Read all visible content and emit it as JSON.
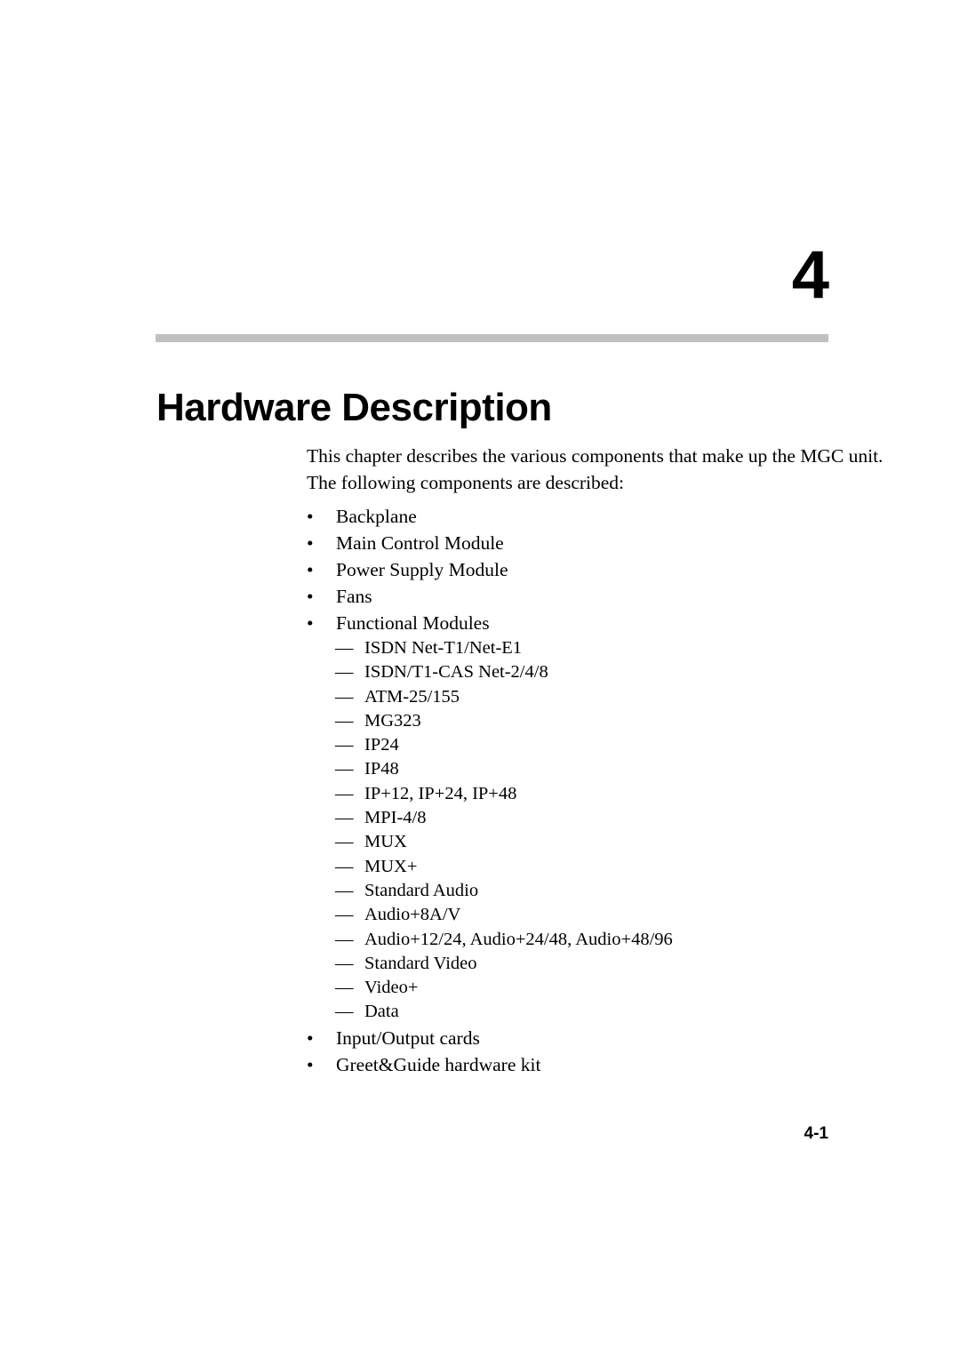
{
  "document": {
    "chapter_number": "4",
    "chapter_title": "Hardware Description",
    "rule_color": "#c0c0c0",
    "text_color": "#000000",
    "background_color": "#ffffff"
  },
  "intro": {
    "line_1": "This chapter describes the various components that make up the MGC unit.",
    "line_2": "The following components are described:"
  },
  "markers": {
    "bullet": "•",
    "dash": "—"
  },
  "list": {
    "items": [
      {
        "label": "Backplane"
      },
      {
        "label": "Main Control Module"
      },
      {
        "label": "Power Supply Module"
      },
      {
        "label": "Fans"
      },
      {
        "label": "Functional Modules",
        "sub_items": [
          {
            "label": "ISDN Net-T1/Net-E1"
          },
          {
            "label": "ISDN/T1-CAS Net-2/4/8"
          },
          {
            "label": "ATM-25/155"
          },
          {
            "label": "MG323"
          },
          {
            "label": "IP24"
          },
          {
            "label": "IP48"
          },
          {
            "label": "IP+12, IP+24, IP+48"
          },
          {
            "label": "MPI-4/8"
          },
          {
            "label": "MUX"
          },
          {
            "label": "MUX+"
          },
          {
            "label": "Standard Audio"
          },
          {
            "label": "Audio+8A/V"
          },
          {
            "label": "Audio+12/24, Audio+24/48, Audio+48/96"
          },
          {
            "label": "Standard Video"
          },
          {
            "label": "Video+"
          },
          {
            "label": "Data"
          }
        ]
      },
      {
        "label": "Input/Output cards"
      },
      {
        "label": "Greet&Guide hardware kit"
      }
    ]
  },
  "footer": {
    "page_number": "4-1"
  }
}
